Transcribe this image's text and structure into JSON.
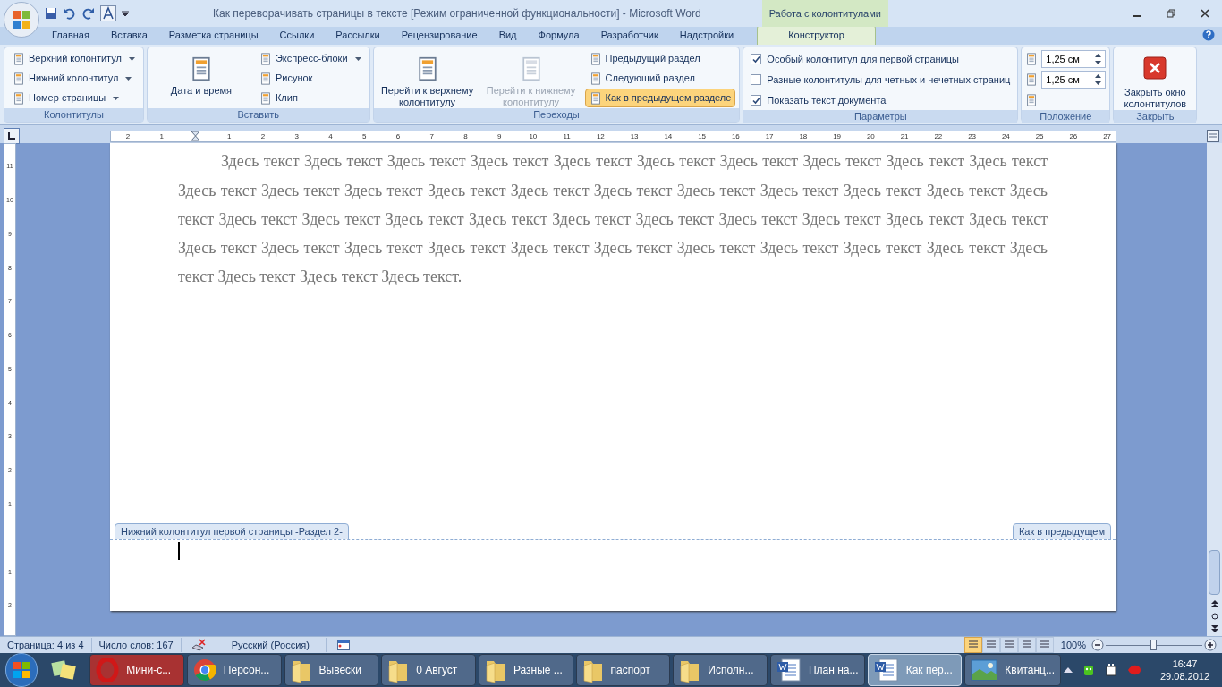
{
  "title_bar": {
    "title": "Как переворачивать страницы в тексте [Режим ограниченной функциональности] - Microsoft Word",
    "context_tab": "Работа с колонтитулами"
  },
  "tabs": [
    {
      "label": "Главная",
      "selected": false
    },
    {
      "label": "Вставка",
      "selected": false
    },
    {
      "label": "Разметка страницы",
      "selected": false
    },
    {
      "label": "Ссылки",
      "selected": false
    },
    {
      "label": "Рассылки",
      "selected": false
    },
    {
      "label": "Рецензирование",
      "selected": false
    },
    {
      "label": "Вид",
      "selected": false
    },
    {
      "label": "Формула",
      "selected": false
    },
    {
      "label": "Разработчик",
      "selected": false
    },
    {
      "label": "Надстройки",
      "selected": false
    },
    {
      "label": "Конструктор",
      "selected": true
    }
  ],
  "ribbon_groups": [
    {
      "label": "Колонтитулы",
      "columns": [
        [
          {
            "kind": "dropdown",
            "label": "Верхний колонтитул"
          },
          {
            "kind": "dropdown",
            "label": "Нижний колонтитул"
          },
          {
            "kind": "dropdown",
            "label": "Номер страницы"
          }
        ]
      ]
    },
    {
      "label": "Вставить",
      "columns": [
        [
          {
            "kind": "big",
            "label": "Дата и время",
            "disabled": false
          }
        ],
        [
          {
            "kind": "dropdown",
            "label": "Экспресс-блоки"
          },
          {
            "kind": "small",
            "label": "Рисунок",
            "selected": false
          },
          {
            "kind": "small",
            "label": "Клип",
            "selected": false
          }
        ]
      ]
    },
    {
      "label": "Переходы",
      "columns": [
        [
          {
            "kind": "big",
            "label": "Перейти к верхнему колонтитулу",
            "disabled": false
          }
        ],
        [
          {
            "kind": "big",
            "label": "Перейти к нижнему колонтитулу",
            "disabled": true
          }
        ],
        [
          {
            "kind": "small",
            "label": "Предыдущий раздел",
            "selected": false
          },
          {
            "kind": "small",
            "label": "Следующий раздел",
            "selected": false
          },
          {
            "kind": "small",
            "label": "Как в предыдущем разделе",
            "selected": true
          }
        ]
      ]
    },
    {
      "label": "Параметры",
      "columns": [
        [
          {
            "kind": "checkbox",
            "label": "Особый колонтитул для первой страницы",
            "checked": true
          },
          {
            "kind": "checkbox",
            "label": "Разные колонтитулы для четных и нечетных страниц",
            "checked": false
          },
          {
            "kind": "checkbox",
            "label": "Показать текст документа",
            "checked": true
          }
        ]
      ]
    },
    {
      "label": "Положение",
      "columns": [
        [
          {
            "kind": "spinner",
            "value": "1,25 см"
          },
          {
            "kind": "spinner",
            "value": "1,25 см"
          },
          {
            "kind": "icon"
          }
        ]
      ]
    },
    {
      "label": "Закрыть",
      "columns": [
        [
          {
            "kind": "close",
            "label": "Закрыть окно колонтитулов"
          }
        ]
      ]
    }
  ],
  "ruler": {
    "labels": [
      "2",
      "1",
      "1",
      "2",
      "3",
      "4",
      "5",
      "6",
      "7",
      "8",
      "9",
      "10",
      "11",
      "12",
      "13",
      "14",
      "15",
      "16",
      "17",
      "18",
      "19",
      "20",
      "21",
      "22",
      "23",
      "24",
      "25",
      "26",
      "27"
    ]
  },
  "vertical_ruler": {
    "top_labels": [
      "11",
      "10",
      "9",
      "8",
      "7",
      "6",
      "5",
      "4",
      "3",
      "2",
      "1"
    ],
    "bottom_labels": [
      "1",
      "2"
    ]
  },
  "document": {
    "paragraph": "Здесь текст Здесь текст Здесь текст Здесь текст Здесь текст Здесь текст Здесь текст Здесь текст Здесь текст Здесь текст Здесь текст Здесь текст Здесь текст Здесь текст Здесь текст Здесь текст Здесь текст Здесь текст Здесь текст Здесь текст Здесь текст Здесь текст Здесь текст Здесь текст Здесь текст Здесь текст Здесь текст Здесь текст Здесь текст Здесь текст Здесь текст Здесь текст Здесь текст Здесь текст Здесь текст Здесь текст Здесь текст Здесь текст Здесь текст Здесь текст Здесь текст Здесь текст Здесь текст Здесь текст Здесь текст.",
    "footer_label": "Нижний колонтитул первой страницы -Раздел 2-",
    "footer_link_label": "Как в предыдущем"
  },
  "status_bar": {
    "page": "Страница: 4 из 4",
    "words": "Число слов: 167",
    "language": "Русский (Россия)",
    "views": [
      {
        "selected": true
      },
      {
        "selected": false
      },
      {
        "selected": false
      },
      {
        "selected": false
      },
      {
        "selected": false
      }
    ],
    "zoom": "100%",
    "zoom_level": {
      "level": 0.5
    }
  },
  "taskbar": {
    "items": [
      {
        "kind": "opera",
        "label": "Мини-с...",
        "selected": false,
        "color": "#a83232"
      },
      {
        "kind": "chrome",
        "label": "Персон...",
        "selected": false
      },
      {
        "kind": "folder",
        "label": "Вывески",
        "selected": false
      },
      {
        "kind": "folder",
        "label": "0 Август",
        "selected": false
      },
      {
        "kind": "folder",
        "label": "Разные ...",
        "selected": false
      },
      {
        "kind": "folder",
        "label": "паспорт",
        "selected": false
      },
      {
        "kind": "folder",
        "label": "Исполн...",
        "selected": false
      },
      {
        "kind": "word",
        "label": "План на...",
        "selected": false
      },
      {
        "kind": "word",
        "label": "Как пер...",
        "selected": true
      },
      {
        "kind": "image",
        "label": "Квитанц...",
        "selected": false
      }
    ],
    "time": "16:47",
    "date": "29.08.2012"
  }
}
